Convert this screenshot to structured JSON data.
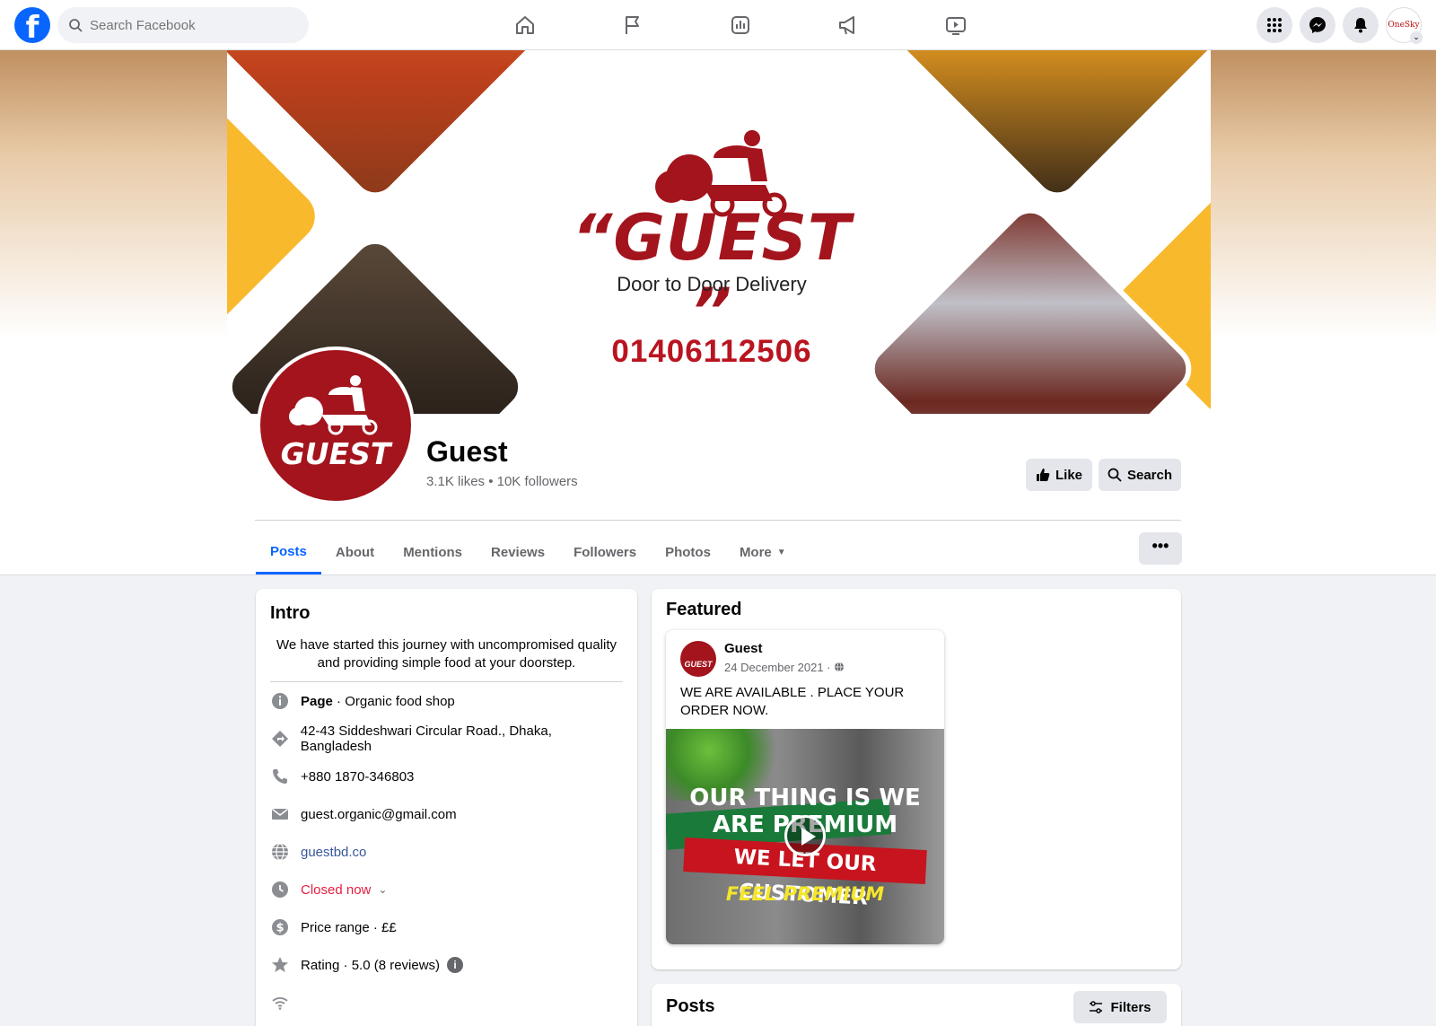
{
  "nav": {
    "logo": "f",
    "search_placeholder": "Search Facebook",
    "icons": [
      "home-icon",
      "pages-flag-icon",
      "insights-icon",
      "ads-megaphone-icon",
      "watch-video-icon"
    ],
    "profile_label": "OneSky"
  },
  "cover": {
    "brand": "“GUEST ”",
    "tagline": "Door to Door Delivery",
    "phone": "01406112506"
  },
  "profile": {
    "avatar_text": "GUEST",
    "name": "Guest",
    "stats": "3.1K likes • 10K followers",
    "like_label": "Like",
    "search_label": "Search"
  },
  "tabs": {
    "items": [
      "Posts",
      "About",
      "Mentions",
      "Reviews",
      "Followers",
      "Photos",
      "More"
    ],
    "active": "Posts",
    "more_options": "•••"
  },
  "intro": {
    "title": "Intro",
    "bio": "We have started this journey with uncompromised quality and providing simple food at your doorstep.",
    "category_bold": "Page",
    "category_rest": " · Organic food shop",
    "address": "42-43 Siddeshwari Circular Road., Dhaka, Bangladesh",
    "phone": "+880 1870-346803",
    "email": "guest.organic@gmail.com",
    "website": "guestbd.co",
    "hours": "Closed now",
    "price": "Price range · ££",
    "rating": "Rating · 5.0 (8 reviews)",
    "rating_info": "i"
  },
  "featured": {
    "title": "Featured",
    "post": {
      "avatar_text": "GUEST",
      "author": "Guest",
      "date": "24 December 2021 · ",
      "text": "WE ARE AVAILABLE . PLACE YOUR ORDER NOW.",
      "media_line1": "OUR THING IS WE ARE PREMIUM",
      "media_line2": "WE LET OUR CUSTOMER",
      "media_line3": "FEEL PREMIUM"
    }
  },
  "posts": {
    "title": "Posts",
    "filters_label": "Filters"
  },
  "colors": {
    "brand_red": "#a3141d",
    "facebook_blue": "#0866ff",
    "closed_red": "#e41e3f",
    "cover_yellow": "#f9b92c"
  }
}
